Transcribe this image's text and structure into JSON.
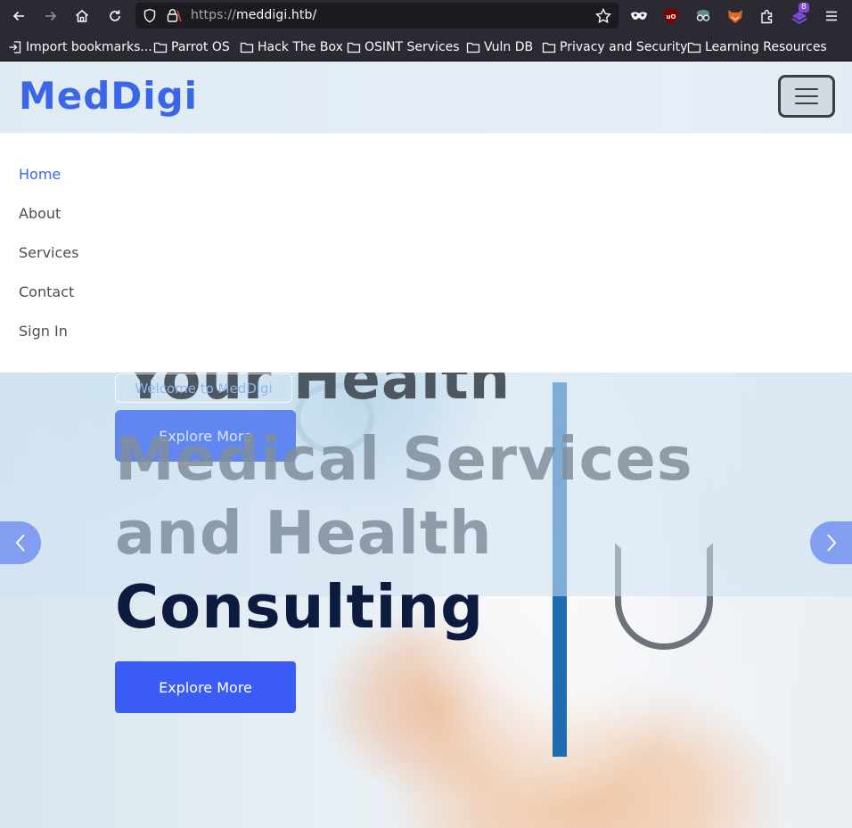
{
  "browser": {
    "url_scheme": "https://",
    "url_host": "meddigi.htb/",
    "extensions_badge": "8",
    "bookmarks": [
      {
        "label": "Import bookmarks...",
        "icon": "import-icon"
      },
      {
        "label": "Parrot OS",
        "icon": "folder-icon"
      },
      {
        "label": "Hack The Box",
        "icon": "folder-icon"
      },
      {
        "label": "OSINT Services",
        "icon": "folder-icon"
      },
      {
        "label": "Vuln DB",
        "icon": "folder-icon"
      },
      {
        "label": "Privacy and Security",
        "icon": "folder-icon"
      },
      {
        "label": "Learning Resources",
        "icon": "folder-icon"
      }
    ]
  },
  "site": {
    "brand": "MedDigi",
    "accent": "#3b66e8",
    "menu": [
      {
        "label": "Home",
        "active": true
      },
      {
        "label": "About",
        "active": false
      },
      {
        "label": "Services",
        "active": false
      },
      {
        "label": "Contact",
        "active": false
      },
      {
        "label": "Sign In",
        "active": false
      }
    ]
  },
  "hero": {
    "ghost_title": "Your Health",
    "ghost_welcome": "Welcome to MedDigi",
    "ghost_button": "Explore More",
    "title_line1": "Medical Services",
    "title_line2": "and Health",
    "title_line3": "Consulting",
    "button": "Explore More",
    "button_color": "#3a5cf5"
  }
}
